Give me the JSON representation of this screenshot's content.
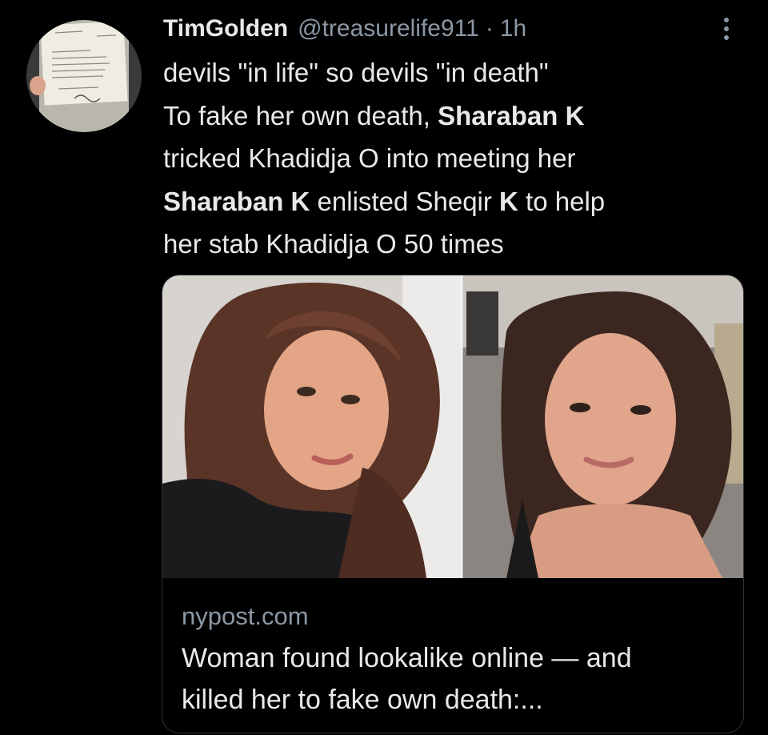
{
  "tweet": {
    "author": {
      "display_name": "TimGolden",
      "handle": "@treasurelife911",
      "separator": "·",
      "time": "1h"
    },
    "more_icon": "more-vertical-icon",
    "lines": [
      [
        {
          "text": "devils \"in life\" so devils \"in death\"",
          "bold": false
        }
      ],
      [
        {
          "text": "To fake her own death, ",
          "bold": false
        },
        {
          "text": "Sharaban K",
          "bold": true
        }
      ],
      [
        {
          "text": "tricked Khadidja O into meeting her",
          "bold": false
        }
      ],
      [
        {
          "text": "Sharaban K",
          "bold": true
        },
        {
          "text": " enlisted Sheqir ",
          "bold": false
        },
        {
          "text": "K",
          "bold": true
        },
        {
          "text": " to help",
          "bold": false
        }
      ],
      [
        {
          "text": "her stab Khadidja O 50 times",
          "bold": false
        }
      ]
    ]
  },
  "link_card": {
    "domain": "nypost.com",
    "headline_lines": [
      "Woman found lookalike online — and",
      "killed her to fake own death:..."
    ]
  },
  "colors": {
    "background": "#000000",
    "primary_text": "#e7e9ea",
    "secondary_text": "#8b98a5",
    "border": "#2f3336"
  }
}
